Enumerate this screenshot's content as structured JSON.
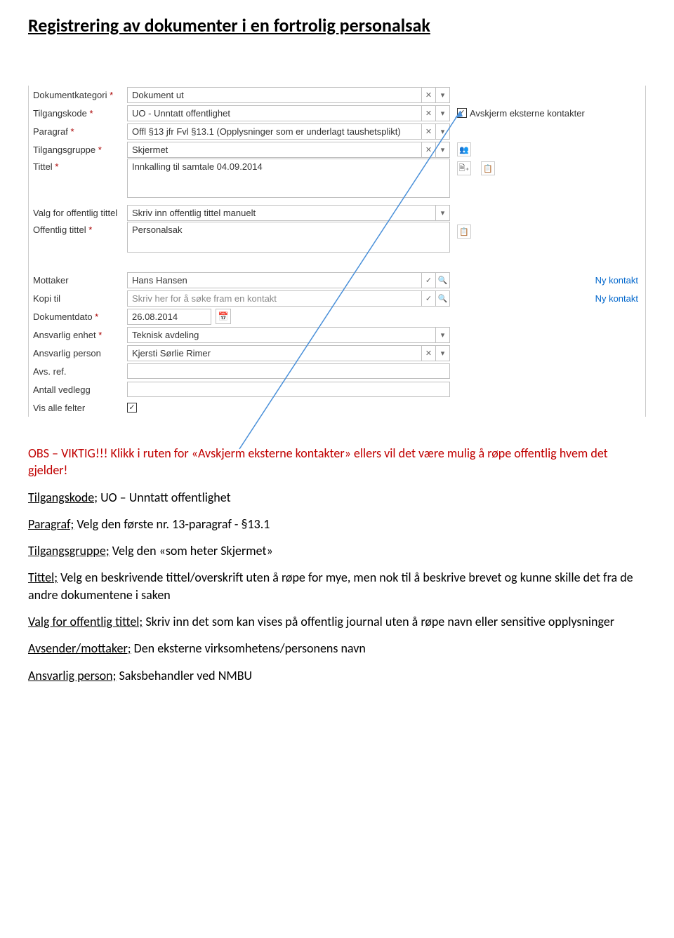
{
  "doc_title": "Registrering av dokumenter i en fortrolig personalsak",
  "form": {
    "labels": {
      "dokumentkategori": "Dokumentkategori",
      "tilgangskode": "Tilgangskode",
      "paragraf": "Paragraf",
      "tilgangsgruppe": "Tilgangsgruppe",
      "tittel": "Tittel",
      "valg_off_tittel": "Valg for offentlig tittel",
      "offentlig_tittel": "Offentlig tittel",
      "mottaker": "Mottaker",
      "kopi_til": "Kopi til",
      "dokumentdato": "Dokumentdato",
      "ansvarlig_enhet": "Ansvarlig enhet",
      "ansvarlig_person": "Ansvarlig person",
      "avs_ref": "Avs. ref.",
      "antall_vedlegg": "Antall vedlegg",
      "vis_alle_felter": "Vis alle felter"
    },
    "values": {
      "dokumentkategori": "Dokument ut",
      "tilgangskode": "UO - Unntatt offentlighet",
      "paragraf": "Offl §13 jfr Fvl §13.1 (Opplysninger som er underlagt taushetsplikt)",
      "tilgangsgruppe": "Skjermet",
      "tittel": "Innkalling til samtale 04.09.2014",
      "valg_off_tittel": "Skriv inn offentlig tittel manuelt",
      "offentlig_tittel": "Personalsak",
      "mottaker": "Hans Hansen",
      "kopi_til_ph": "Skriv her for å søke fram en kontakt",
      "dokumentdato": "26.08.2014",
      "ansvarlig_enhet": "Teknisk avdeling",
      "ansvarlig_person": "Kjersti Sørlie Rimer",
      "avs_ref": "",
      "antall_vedlegg": ""
    },
    "avskjerm_label": "Avskjerm eksterne kontakter",
    "ny_kontakt": "Ny kontakt",
    "req_mark": " *",
    "ctl": {
      "x": "✕",
      "down": "▾",
      "check": "✓",
      "search": "🔍"
    }
  },
  "body": {
    "obs1": "OBS – VIKTIG!!!",
    "obs2": " Klikk i ruten for «Avskjerm eksterne kontakter» ellers vil det være mulig å røpe offentlig hvem det gjelder!",
    "tilgangskode_lbl": "Tilgangskode;",
    "tilgangskode_txt": " UO – Unntatt offentlighet",
    "paragraf_lbl": "Paragraf;",
    "paragraf_txt": " Velg den første nr. 13-paragraf - §13.1",
    "tilgangsgruppe_lbl": "Tilgangsgruppe;",
    "tilgangsgruppe_txt": " Velg den «som heter Skjermet»",
    "tittel_lbl": "Tittel;",
    "tittel_txt": " Velg en beskrivende tittel/overskrift uten å røpe for mye, men nok til å beskrive brevet og kunne skille det fra de andre dokumentene i saken",
    "valg_lbl": "Valg for offentlig tittel;",
    "valg_txt": " Skriv inn det som kan vises på offentlig journal uten å røpe navn eller sensitive opplysninger",
    "avsender_lbl": "Avsender/mottaker;",
    "avsender_txt": " Den eksterne virksomhetens/personens navn",
    "ansvarlig_lbl": "Ansvarlig person;",
    "ansvarlig_txt": " Saksbehandler ved NMBU"
  }
}
